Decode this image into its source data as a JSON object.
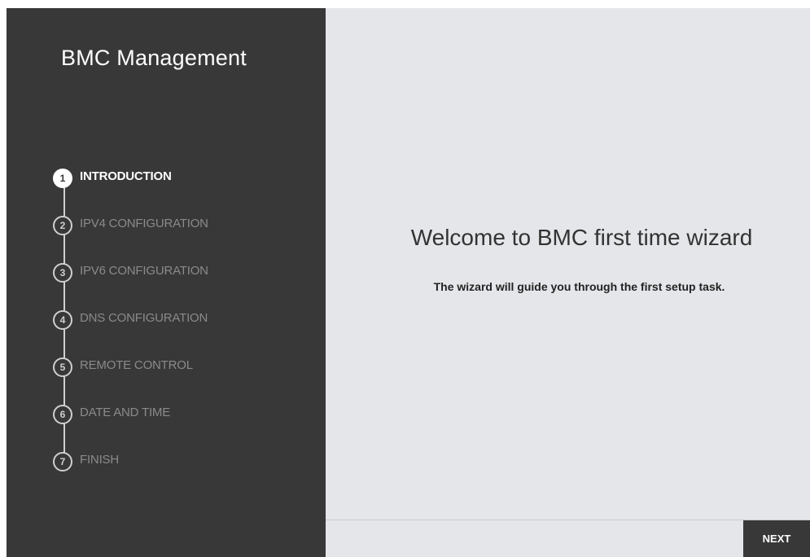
{
  "app": {
    "title": "BMC Management"
  },
  "wizard": {
    "steps": [
      {
        "number": "1",
        "label": "INTRODUCTION",
        "active": true
      },
      {
        "number": "2",
        "label": "IPV4 CONFIGURATION",
        "active": false
      },
      {
        "number": "3",
        "label": "IPV6 CONFIGURATION",
        "active": false
      },
      {
        "number": "4",
        "label": "DNS CONFIGURATION",
        "active": false
      },
      {
        "number": "5",
        "label": "REMOTE CONTROL",
        "active": false
      },
      {
        "number": "6",
        "label": "DATE AND TIME",
        "active": false
      },
      {
        "number": "7",
        "label": "FINISH",
        "active": false
      }
    ],
    "current_step": 1
  },
  "main": {
    "title": "Welcome to BMC first time wizard",
    "subtitle": "The wizard will guide you through the first setup task."
  },
  "footer": {
    "next_label": "NEXT"
  },
  "colors": {
    "sidebar_bg": "#383838",
    "main_bg": "#e4e6e9",
    "active_text": "#ffffff",
    "inactive_text": "#8a8a8a",
    "button_bg": "#383838"
  }
}
